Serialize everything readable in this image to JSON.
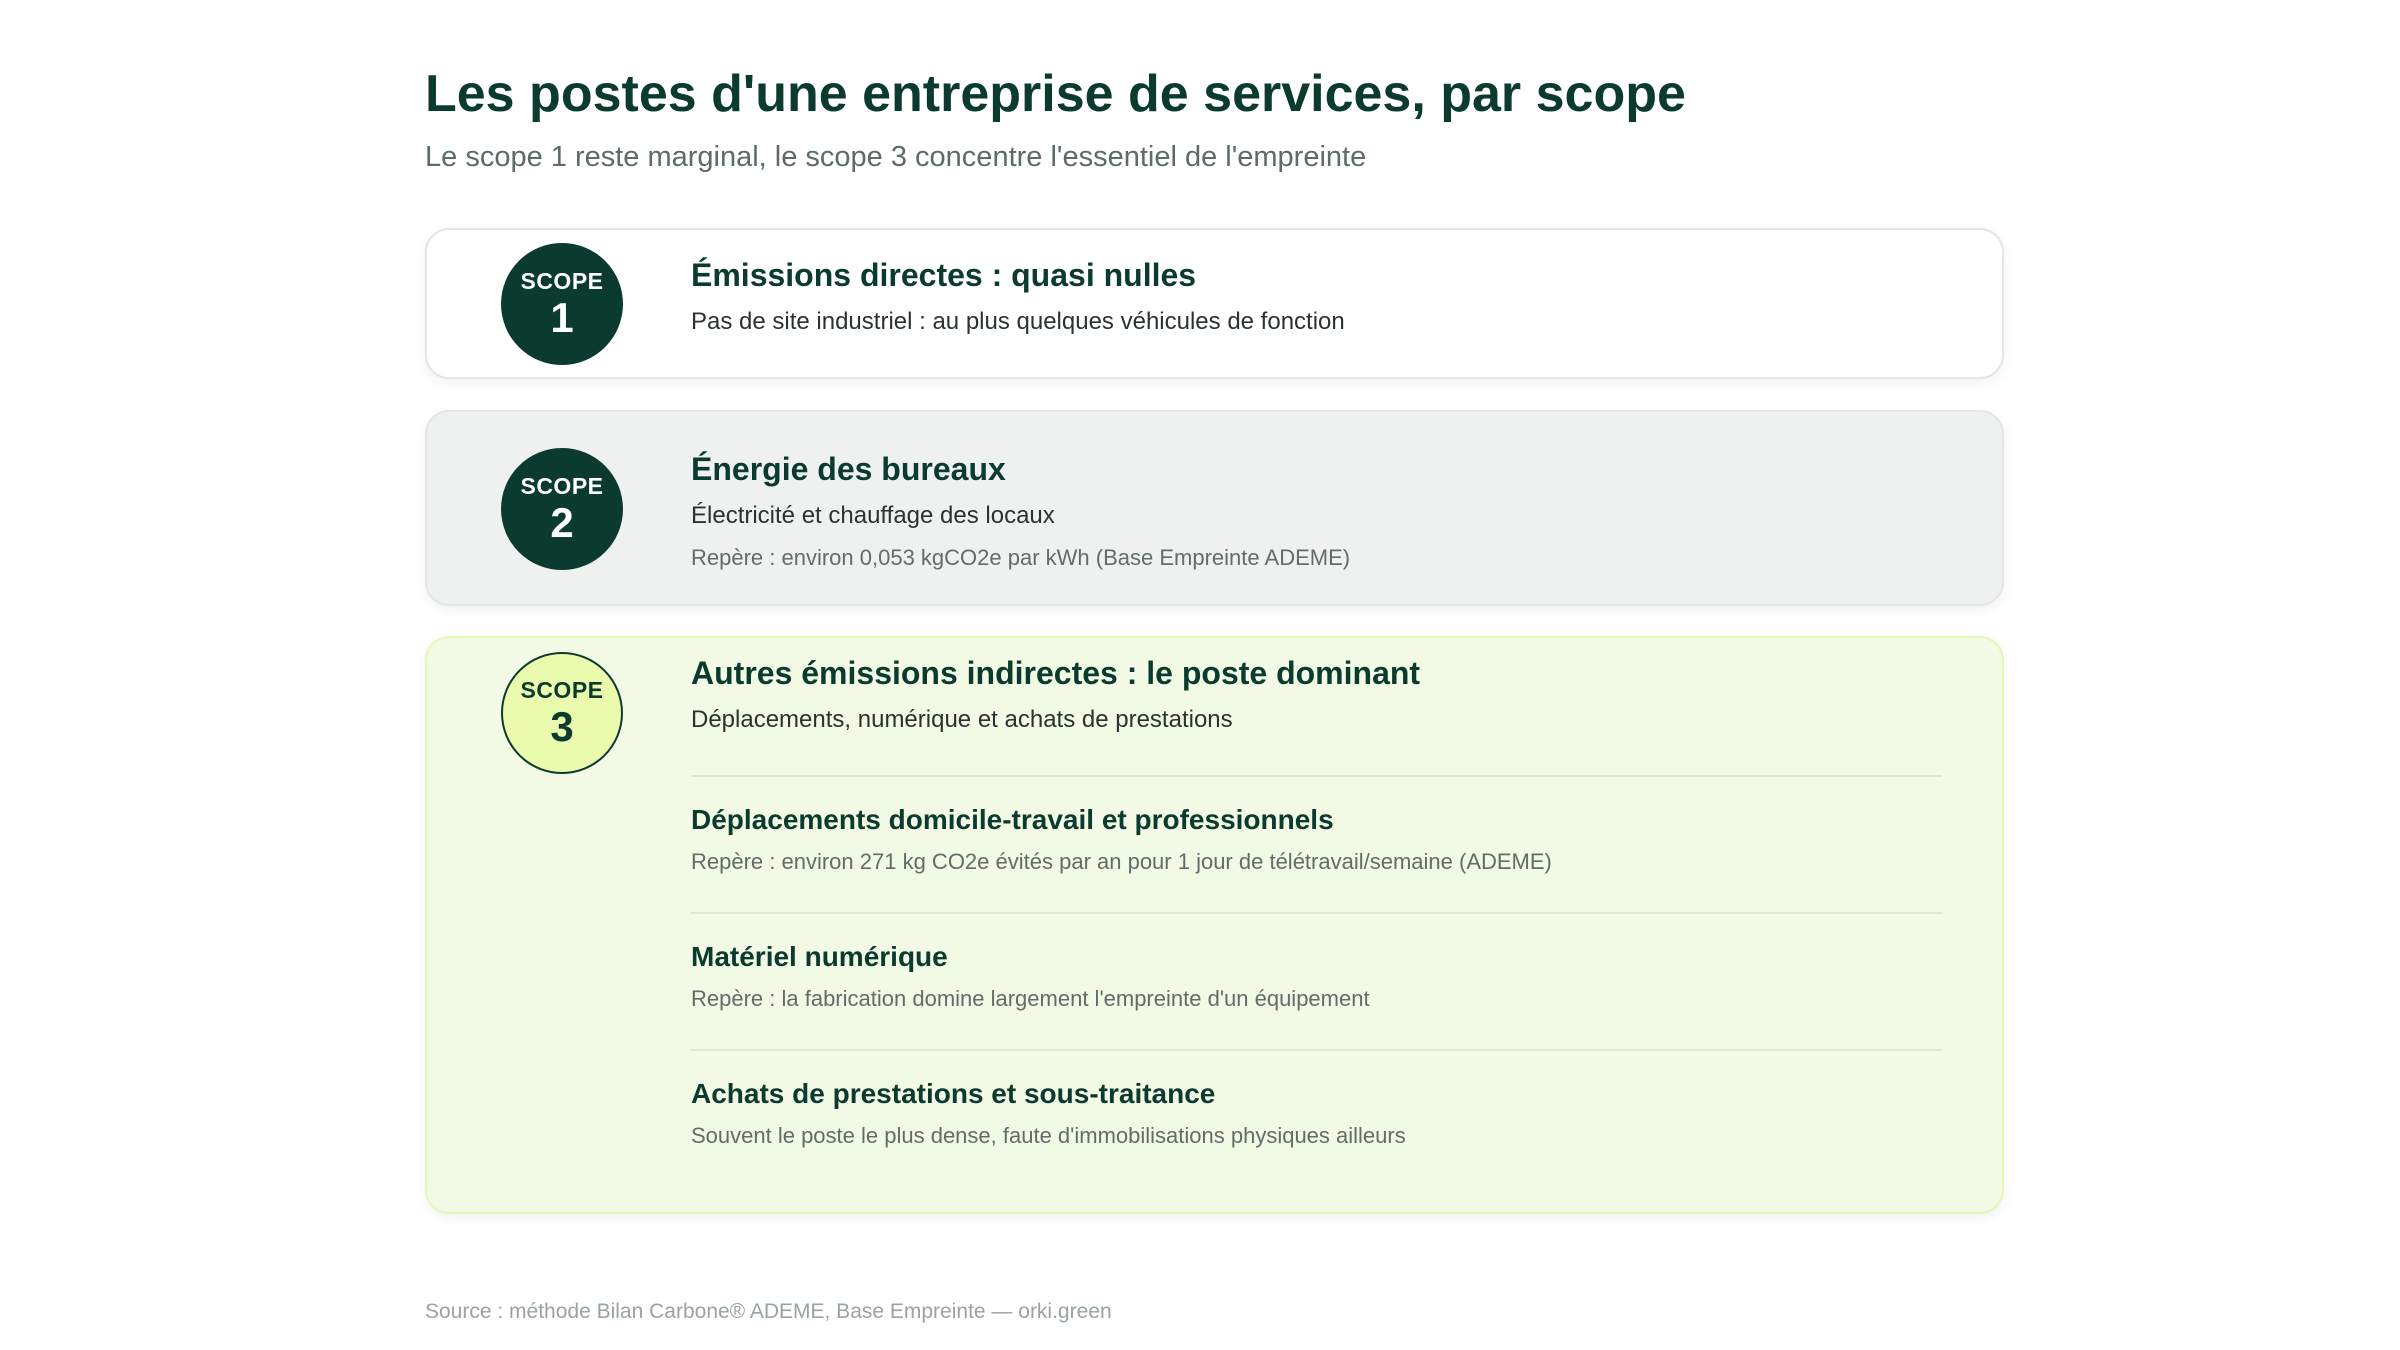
{
  "title": "Les postes d'une entreprise de services, par scope",
  "subtitle": "Le scope 1 reste marginal, le scope 3 concentre l'essentiel de l'empreinte",
  "colors": {
    "dark_green": "#0b3a2e",
    "lime": "#ebfbae",
    "scope3_bg": "#f2f9e5",
    "scope2_bg": "#eff1f0"
  },
  "scopes": [
    {
      "badge_word": "SCOPE",
      "badge_number": "1",
      "heading": "Émissions directes : quasi nulles",
      "description": "Pas de site industriel : au plus quelques véhicules de fonction"
    },
    {
      "badge_word": "SCOPE",
      "badge_number": "2",
      "heading": "Énergie des bureaux",
      "description": "Électricité et chauffage des locaux",
      "reference": "Repère : environ 0,053 kgCO2e par kWh (Base Empreinte ADEME)"
    },
    {
      "badge_word": "SCOPE",
      "badge_number": "3",
      "heading": "Autres émissions indirectes : le poste dominant",
      "description": "Déplacements, numérique et achats de prestations",
      "items": [
        {
          "title": "Déplacements domicile-travail et professionnels",
          "detail": "Repère : environ 271 kg CO2e évités par an pour 1 jour de télétravail/semaine (ADEME)"
        },
        {
          "title": "Matériel numérique",
          "detail": "Repère : la fabrication domine largement l'empreinte d'un équipement"
        },
        {
          "title": "Achats de prestations et sous-traitance",
          "detail": "Souvent le poste le plus dense, faute d'immobilisations physiques ailleurs"
        }
      ]
    }
  ],
  "source": "Source : méthode Bilan Carbone® ADEME, Base Empreinte — orki.green"
}
